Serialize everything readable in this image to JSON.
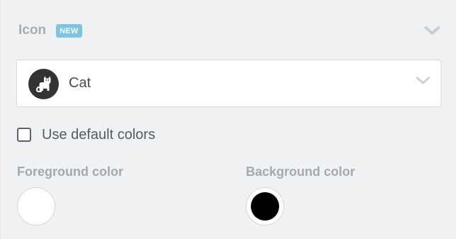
{
  "section": {
    "title": "Icon",
    "badge": "NEW"
  },
  "icon_select": {
    "value": "Cat",
    "icon": "cat-icon"
  },
  "use_default_colors": {
    "label": "Use default colors",
    "checked": false
  },
  "foreground": {
    "label": "Foreground color",
    "color": "#ffffff"
  },
  "background": {
    "label": "Background color",
    "color": "#000000"
  }
}
